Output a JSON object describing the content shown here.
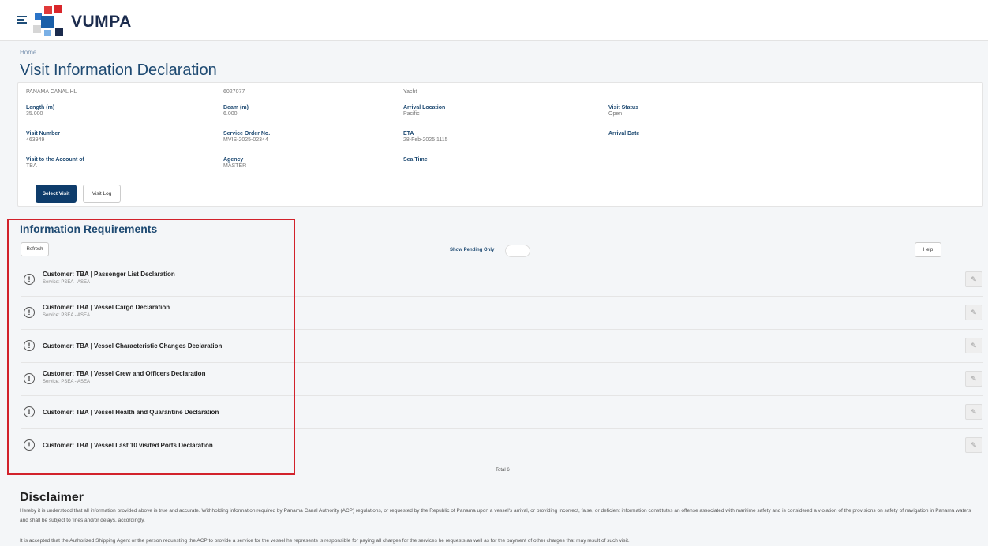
{
  "app": {
    "name": "VUMPA"
  },
  "breadcrumb": {
    "home": "Home"
  },
  "page": {
    "title": "Visit Information Declaration"
  },
  "vessel": {
    "name": "PANAMA CANAL HL",
    "id_number": "6027077",
    "type": "Yacht",
    "length": {
      "label": "Length (m)",
      "value": "35.000"
    },
    "beam": {
      "label": "Beam (m)",
      "value": "6.000"
    },
    "arrival_location": {
      "label": "Arrival Location",
      "value": "Pacific"
    },
    "visit_status": {
      "label": "Visit Status",
      "value": "Open"
    },
    "visit_number": {
      "label": "Visit Number",
      "value": "463949"
    },
    "service_order": {
      "label": "Service Order No.",
      "value": "MVIS-2025-02344"
    },
    "eta": {
      "label": "ETA",
      "value": "28-Feb-2025 1115"
    },
    "arrival_date": {
      "label": "Arrival Date",
      "value": ""
    },
    "account": {
      "label": "Visit to the Account of",
      "value": "TBA"
    },
    "agency": {
      "label": "Agency",
      "value": "MASTER"
    },
    "sea_time": {
      "label": "Sea Time",
      "value": ""
    }
  },
  "buttons": {
    "select_visit": "Select Visit",
    "visit_log": "Visit Log"
  },
  "requirements": {
    "title": "Information Requirements",
    "refresh": "Refresh",
    "show_pending": "Show Pending Only",
    "help": "Help",
    "items": [
      {
        "name": "Customer: TBA | Passenger List Declaration",
        "service": "Service: PSEA - ASEA"
      },
      {
        "name": "Customer: TBA | Vessel Cargo Declaration",
        "service": "Service: PSEA - ASEA"
      },
      {
        "name": "Customer: TBA | Vessel Characteristic Changes Declaration",
        "service": ""
      },
      {
        "name": "Customer: TBA | Vessel Crew and Officers Declaration",
        "service": "Service: PSEA - ASEA"
      },
      {
        "name": "Customer: TBA | Vessel Health and Quarantine Declaration",
        "service": ""
      },
      {
        "name": "Customer: TBA | Vessel Last 10 visited Ports Declaration",
        "service": ""
      }
    ],
    "total": "Total 6"
  },
  "disclaimer": {
    "title": "Disclaimer",
    "p1": "Hereby it is understood that all information provided above is true and accurate. Withholding information required by Panama Canal Authority (ACP) regulations, or requested by the Republic of Panama upon a vessel's arrival, or providing incorrect, false, or deficient information constitutes an offense associated with maritime safety and is considered a violation of the provisions on safety of navigation in Panama waters and shall be subject to fines and/or delays, accordingly.",
    "p2": "It is accepted that the Authorized Shipping Agent or the person requesting the ACP to provide a service for the vessel he represents is responsible for paying all charges for the services he requests as well as for the payment of other charges that may result of such visit."
  },
  "colors": {
    "primary": "#0e3c6b",
    "title": "#1e4a72",
    "highlight": "#d2222b"
  }
}
